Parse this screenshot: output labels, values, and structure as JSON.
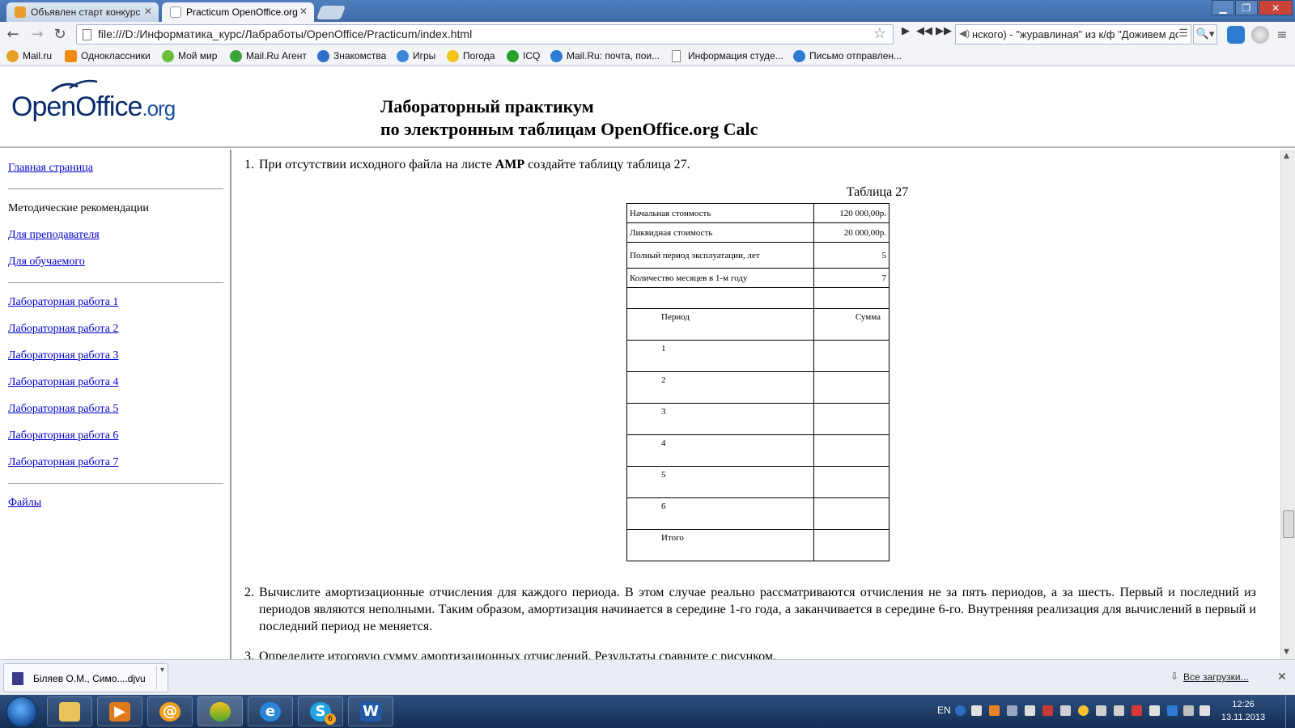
{
  "browser": {
    "tabs": [
      {
        "label": "Объявлен старт конкурс",
        "active": false
      },
      {
        "label": "Practicum OpenOffice.org",
        "active": true
      }
    ],
    "window_controls": {
      "minimize": "▁",
      "maximize": "❐",
      "close": "✕"
    },
    "nav": {
      "back": "←",
      "forward": "→",
      "reload": "↻"
    },
    "url": "file:///D:/Информатика_курс/Лабработы/OpenOffice/Practicum/index.html",
    "media_player": {
      "track": "нского) - \"журавлиная\" из к/ф \"Доживем до",
      "play": "▶",
      "prev": "◀◀",
      "next": "▶▶"
    },
    "search_button": "🔍▾",
    "bookmarks": [
      {
        "label": "Mail.ru"
      },
      {
        "label": "Одноклассники"
      },
      {
        "label": "Мой мир"
      },
      {
        "label": "Mail.Ru Агент"
      },
      {
        "label": "Знакомства"
      },
      {
        "label": "Игры"
      },
      {
        "label": "Погода"
      },
      {
        "label": "ICQ"
      },
      {
        "label": "Mail.Ru: почта, пои..."
      },
      {
        "label": "Информация студе..."
      },
      {
        "label": "Письмо отправлен..."
      }
    ]
  },
  "page": {
    "logo": {
      "main": "OpenOffice",
      "suffix": ".org"
    },
    "title_line1": "Лабораторный практикум",
    "title_line2": "по электронным таблицам OpenOffice.org Calc",
    "sidebar": {
      "home": "Главная страница",
      "method_header": "Методические рекомендации",
      "for_teacher": "Для преподавателя",
      "for_student": "Для обучаемого",
      "labs": [
        "Лабораторная работа 1",
        "Лабораторная работа 2",
        "Лабораторная работа 3",
        "Лабораторная работа 4",
        "Лабораторная работа 5",
        "Лабораторная работа 6",
        "Лабораторная работа 7"
      ],
      "files": "Файлы"
    },
    "content": {
      "item1": {
        "num": "1.",
        "text_before": "При отсутствии исходного файла на листе ",
        "bold": "АМР",
        "text_after": " создайте таблицу таблица 27."
      },
      "table_caption": "Таблица 27",
      "table": {
        "rows": [
          {
            "label": "Начальная стоимость",
            "value": "120 000,00р."
          },
          {
            "label": "Ликвидная стоимость",
            "value": "20 000,00р."
          },
          {
            "label": "Полный период эксплуатации, лет",
            "value": "5"
          },
          {
            "label": "Количество месяцев в 1-м году",
            "value": "7"
          }
        ],
        "header": {
          "period": "Период",
          "sum": "Сумма"
        },
        "periods": [
          "1",
          "2",
          "3",
          "4",
          "5",
          "6",
          "Итого"
        ]
      },
      "item2": {
        "num": "2.",
        "text": "Вычислите амортизационные отчисления для каждого периода. В этом случае реально рассматриваются отчисления не за пять периодов, а за шесть. Первый и последний из периодов являются неполными. Таким образом, амортизация начинается в середине 1-го года, а заканчивается в середине 6-го. Внутренняя реализация для вычислений в первый и последний период не меняется."
      },
      "item3": {
        "num": "3.",
        "text": "Определите итоговую сумму амортизационных отчислений. Результаты сравните с рисунком."
      }
    }
  },
  "downloads": {
    "item": "Біляев О.М., Симо....djvu",
    "show_all": "Все загрузки...",
    "close": "✕"
  },
  "taskbar": {
    "lang": "EN",
    "time": "12:26",
    "date": "13.11.2013",
    "skype_badge": "6"
  }
}
